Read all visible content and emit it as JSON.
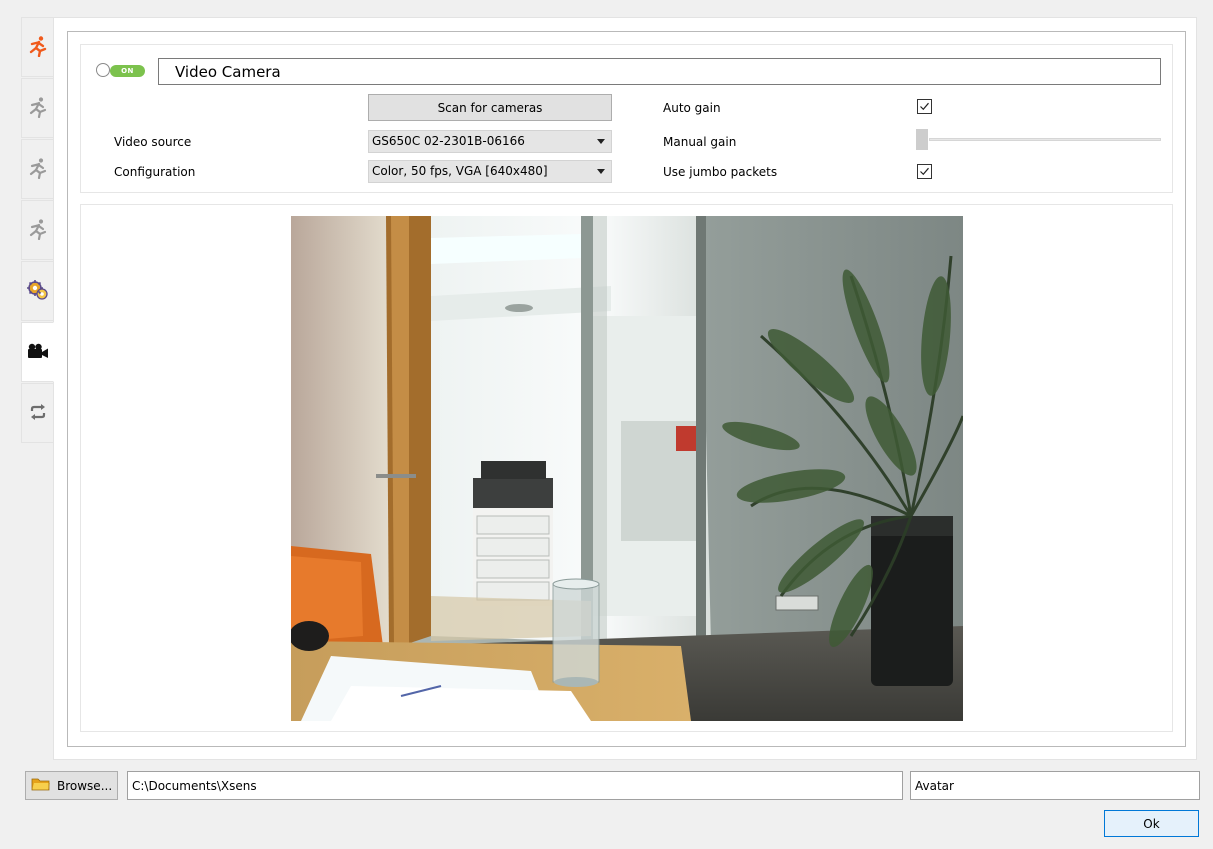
{
  "sidebar": {
    "tabs": [
      {
        "icon": "running-figure-icon",
        "color": "#f05a1c",
        "active": false
      },
      {
        "icon": "running-figure-icon",
        "color": "#9a9a9a",
        "active": false
      },
      {
        "icon": "running-figure-icon",
        "color": "#9a9a9a",
        "active": false
      },
      {
        "icon": "running-figure-icon",
        "color": "#9a9a9a",
        "active": false
      },
      {
        "icon": "settings-gears-icon",
        "color": "#e8a52a",
        "active": false
      },
      {
        "icon": "video-camera-icon",
        "color": "#111111",
        "active": true
      },
      {
        "icon": "sync-arrows-icon",
        "color": "#6d6d6d",
        "active": false
      }
    ]
  },
  "camera": {
    "toggle_label": "ON",
    "toggle_on": true,
    "title": "Video Camera",
    "scan_button": "Scan for cameras",
    "video_source_label": "Video source",
    "video_source_value": "GS650C 02-2301B-06166",
    "configuration_label": "Configuration",
    "configuration_value": "Color, 50 fps, VGA [640x480]",
    "auto_gain_label": "Auto gain",
    "auto_gain_checked": true,
    "manual_gain_label": "Manual gain",
    "manual_gain_level": 0,
    "jumbo_label": "Use jumbo packets",
    "jumbo_checked": true
  },
  "footer": {
    "browse_label": "Browse...",
    "path_value": "C:\\Documents\\Xsens",
    "name_value": "Avatar",
    "ok_label": "Ok"
  },
  "colors": {
    "toggle_on": "#7cc24d",
    "accent": "#0078d7",
    "runner_active": "#f05a1c"
  }
}
